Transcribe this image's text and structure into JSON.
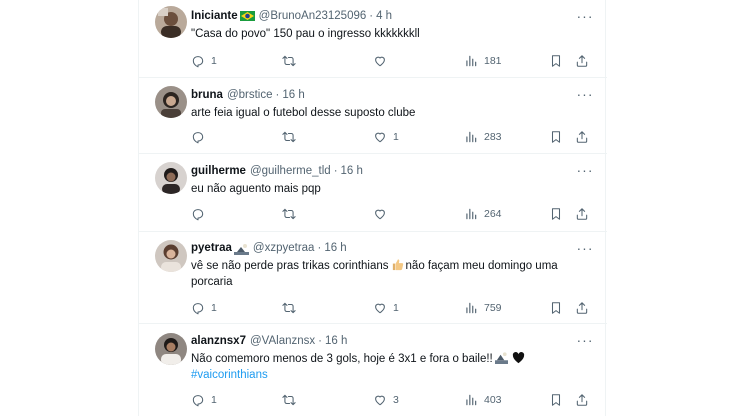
{
  "replies": [
    {
      "name": "Iniciante",
      "has_flag": true,
      "handle": "@BrunoAn23125096",
      "dot": "·",
      "time": "4 h",
      "text": "\"Casa do povo\" 150 pau o ingresso kkkkkkkll",
      "counts": {
        "reply": "1",
        "retweet": "",
        "like": "",
        "views": "181"
      }
    },
    {
      "name": "bruna",
      "handle": "@brstice",
      "dot": "·",
      "time": "16 h",
      "text": "arte feia igual o futebol desse suposto clube",
      "counts": {
        "reply": "",
        "retweet": "",
        "like": "1",
        "views": "283"
      }
    },
    {
      "name": "guilherme",
      "handle": "@guilherme_tld",
      "dot": "·",
      "time": "16 h",
      "text": "eu não aguento mais pqp",
      "counts": {
        "reply": "",
        "retweet": "",
        "like": "",
        "views": "264"
      }
    },
    {
      "name": "pyetraa",
      "handle": "@xzpyetraa",
      "dot": "·",
      "time": "16 h",
      "text_a": "vê se não perde pras trikas corinthians",
      "text_b": "não façam meu domingo uma porcaria",
      "counts": {
        "reply": "1",
        "retweet": "",
        "like": "1",
        "views": "759"
      }
    },
    {
      "name": "alanznsx7",
      "handle": "@VAlanznsx",
      "dot": "·",
      "time": "16 h",
      "text": "Não comemoro menos de 3 gols, hoje é 3x1 e fora o baile!!",
      "hashtag": "#vaicorinthians",
      "counts": {
        "reply": "1",
        "retweet": "",
        "like": "3",
        "views": "403"
      }
    }
  ],
  "icons": {
    "reply": "reply-icon",
    "retweet": "retweet-icon",
    "like": "like-icon",
    "views": "views-icon",
    "bookmark": "bookmark-icon",
    "share": "share-icon",
    "more": "more-icon"
  },
  "colors": {
    "text": "#0f1419",
    "muted": "#536471",
    "link": "#1d9bf0",
    "divider": "#eff3f4"
  }
}
